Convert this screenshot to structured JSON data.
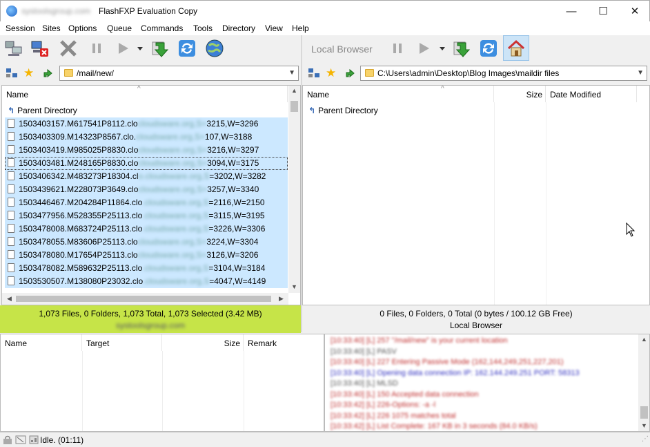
{
  "window": {
    "host": "systoolsgroup.com",
    "title": "FlashFXP Evaluation Copy",
    "minimize": "—",
    "maximize": "☐",
    "close": "✕"
  },
  "menu": [
    "Session",
    "Sites",
    "Options",
    "Queue",
    "Commands",
    "Tools",
    "Directory",
    "View",
    "Help"
  ],
  "remote": {
    "path": "/mail/new/",
    "column_name": "Name",
    "parent": "Parent Directory",
    "files": [
      {
        "a": "1503403157.M617541P8112.clo",
        "b": "cloudsware.org,S=",
        "c": "3215,W=3296"
      },
      {
        "a": "1503403309.M14323P8567.clo.",
        "b": "cloudsware.org,S=",
        "c": "107,W=3188"
      },
      {
        "a": "1503403419.M985025P8830.clo",
        "b": "cloudsware.org,S=",
        "c": "3216,W=3297"
      },
      {
        "a": "1503403481.M248165P8830.clo",
        "b": "cloudsware.org,S=",
        "c": "3094,W=3175"
      },
      {
        "a": "1503406342.M483273P18304.cl",
        "b": "o.cloudsware.org,S",
        "c": "=3202,W=3282"
      },
      {
        "a": "1503439621.M228073P3649.clo",
        "b": "cloudsware.org,S=",
        "c": "3257,W=3340"
      },
      {
        "a": "1503446467.M204284P11864.clo",
        "b": ".cloudsware.org,S",
        "c": "=2116,W=2150"
      },
      {
        "a": "1503477956.M528355P25113.clo",
        "b": ".cloudsware.org,S",
        "c": "=3115,W=3195"
      },
      {
        "a": "1503478008.M683724P25113.clo",
        "b": ".cloudsware.org,S",
        "c": "=3226,W=3306"
      },
      {
        "a": "1503478055.M83606P25113.clo",
        "b": "cloudsware.org,S=",
        "c": "3224,W=3304"
      },
      {
        "a": "1503478080.M17654P25113.clo",
        "b": "cloudsware.org,S=",
        "c": "3126,W=3206"
      },
      {
        "a": "1503478082.M589632P25113.clo",
        "b": ".cloudsware.org,S",
        "c": "=3104,W=3184"
      },
      {
        "a": "1503530507.M138080P23032.clo",
        "b": ".cloudsware.org,S",
        "c": "=4047,W=4149"
      }
    ],
    "status": "1,073 Files, 0 Folders, 1,073 Total, 1,073 Selected (3.42 MB)",
    "status_host": "systoolsgroup.com"
  },
  "local": {
    "label": "Local Browser",
    "path": "C:\\Users\\admin\\Desktop\\Blog Images\\maildir files",
    "column_name": "Name",
    "column_size": "Size",
    "column_date": "Date Modified",
    "parent": "Parent Directory",
    "status": "0 Files, 0 Folders, 0 Total (0 bytes / 100.12 GB Free)",
    "status_label": "Local Browser"
  },
  "queue": {
    "col_name": "Name",
    "col_target": "Target",
    "col_size": "Size",
    "col_remark": "Remark"
  },
  "log": [
    {
      "text": "[10:33:40] [L] 257 \"/mail/new\" is your current location",
      "color": "#c03030"
    },
    {
      "text": "[10:33:40] [L] PASV",
      "color": "#555555"
    },
    {
      "text": "[10:33:40] [L] 227 Entering Passive Mode (162,144,249,251,227,201)",
      "color": "#c03030"
    },
    {
      "text": "[10:33:40] [L] Opening data connection IP: 162.144.249.251 PORT: 58313",
      "color": "#3030c0"
    },
    {
      "text": "[10:33:40] [L] MLSD",
      "color": "#555555"
    },
    {
      "text": "[10:33:40] [L] 150 Accepted data connection",
      "color": "#c03030"
    },
    {
      "text": "[10:33:42] [L] 226-Options: -a -l",
      "color": "#c03030"
    },
    {
      "text": "[10:33:42] [L] 226 1075 matches total",
      "color": "#c03030"
    },
    {
      "text": "[10:33:42] [L] List Complete: 167 KB in 3 seconds (84.0 KB/s)",
      "color": "#c03030"
    }
  ],
  "statusbar": {
    "text": "Idle. (01:11)"
  },
  "colors": {
    "remote_status_bg": "#c6e448",
    "selection": "#cce8ff"
  }
}
